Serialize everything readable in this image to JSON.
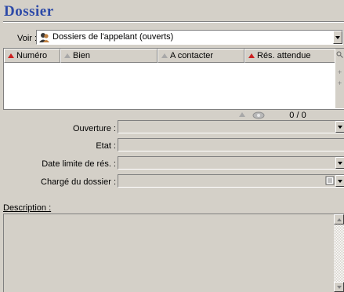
{
  "window": {
    "title": "Dossier"
  },
  "voir": {
    "label": "Voir :",
    "value": "Dossiers de l'appelant (ouverts)",
    "icon": "users-icon"
  },
  "list": {
    "columns": [
      {
        "label": "Numéro",
        "sort_color": "#cc2020"
      },
      {
        "label": "Bien",
        "sort_color": "#a8a8a8"
      },
      {
        "label": "A contacter",
        "sort_color": "#a8a8a8"
      },
      {
        "label": "Rés. attendue",
        "sort_color": "#cc2020"
      }
    ],
    "rows": [],
    "counter": "0 / 0"
  },
  "form": {
    "ouverture": {
      "label": "Ouverture :",
      "value": ""
    },
    "etat": {
      "label": "Etat :",
      "value": ""
    },
    "date_limite": {
      "label": "Date limite de rés. :",
      "value": ""
    },
    "charge": {
      "label": "Chargé du dossier :",
      "value": ""
    }
  },
  "description": {
    "label": "Description :",
    "value": ""
  },
  "colors": {
    "title": "#2d4aa8",
    "background": "#d4d0c8",
    "sort_active": "#cc2020"
  }
}
